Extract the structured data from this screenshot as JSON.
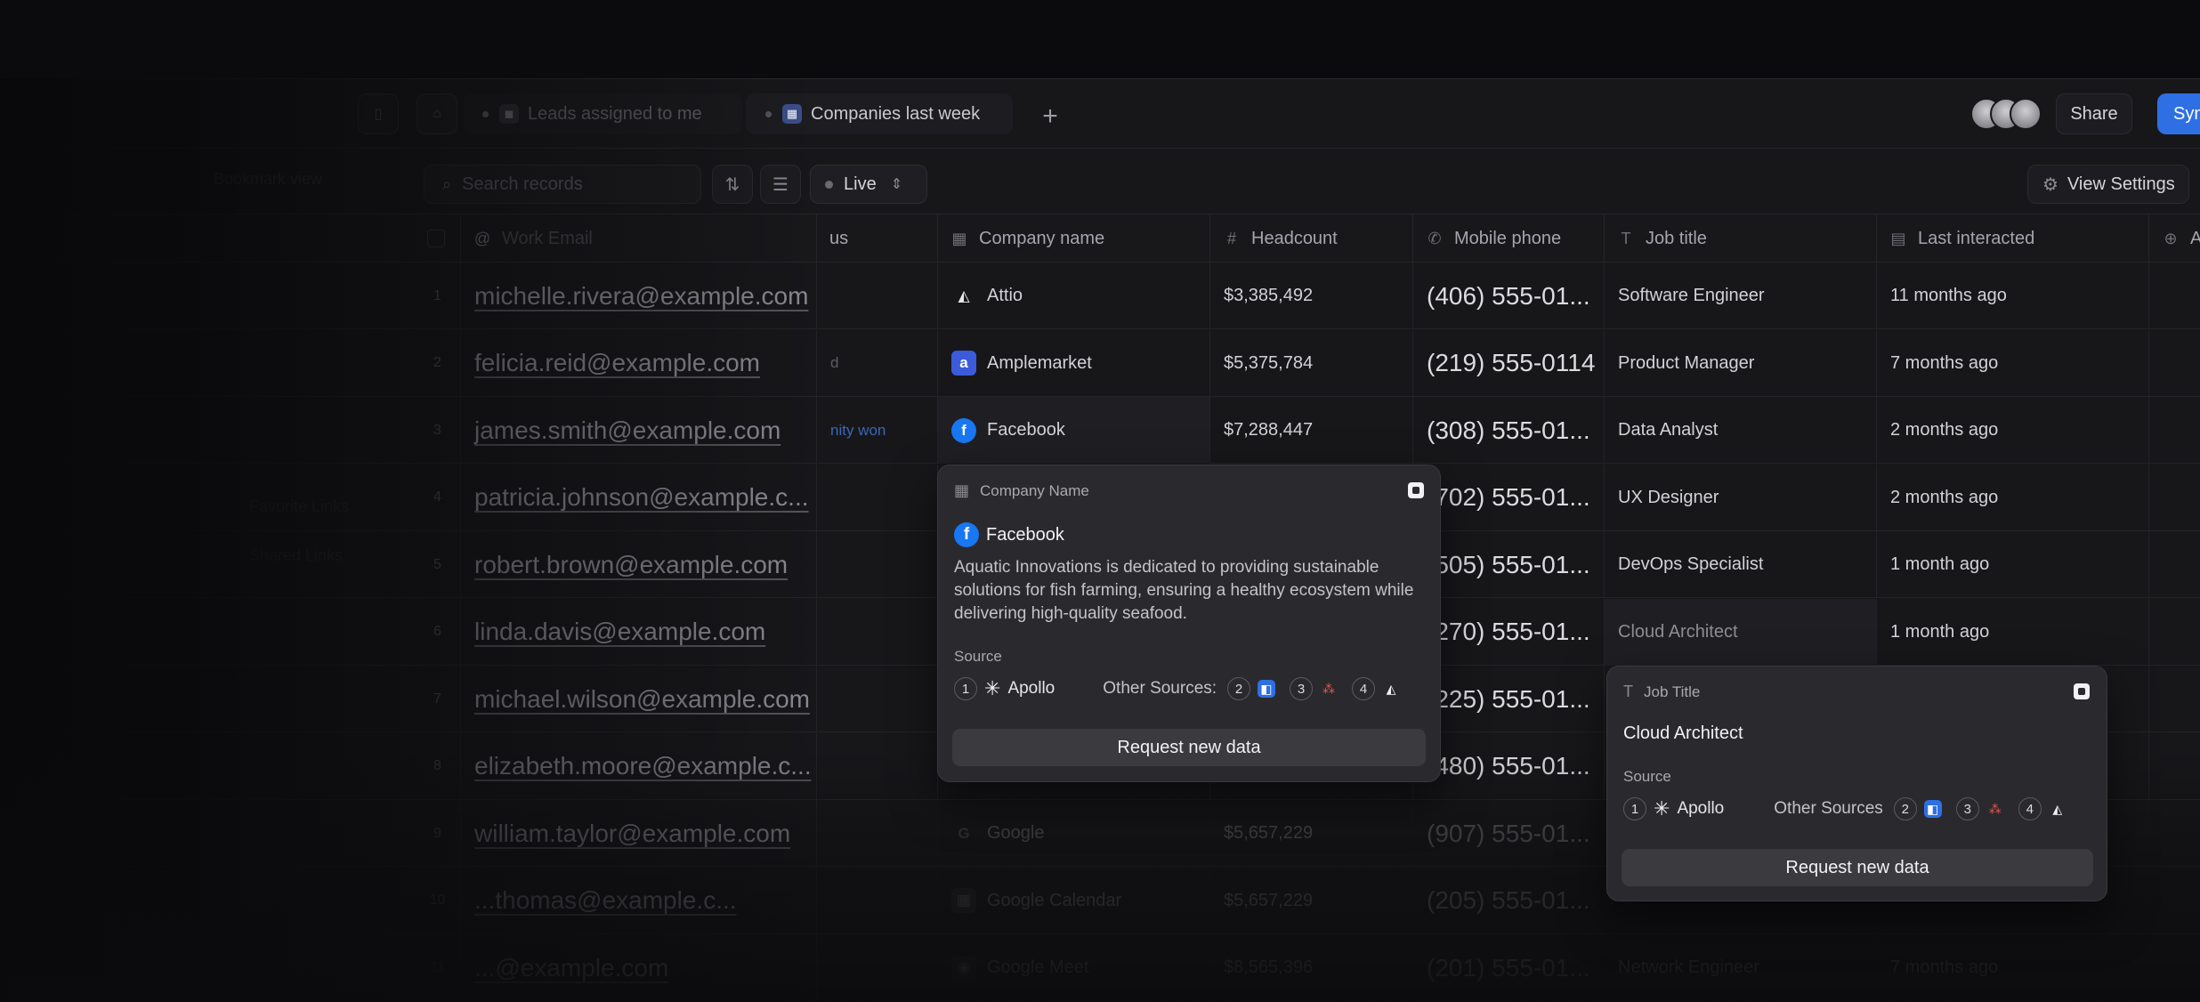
{
  "tabs": [
    {
      "label": "Leads assigned to me"
    },
    {
      "label": "Companies last week"
    }
  ],
  "share_label": "Share",
  "sync_label": "Syn",
  "left_label": "Bookmark view",
  "search": {
    "placeholder": "Search records"
  },
  "live_label": "Live",
  "view_settings_label": "View Settings",
  "columns": {
    "email": "Work Email",
    "status": "us",
    "company": "Company name",
    "headcount": "Headcount",
    "phone": "Mobile phone",
    "job": "Job title",
    "last": "Last interacted",
    "add": "A"
  },
  "rows": [
    {
      "num": "1",
      "email": "michelle.rivera@example.com",
      "status": "",
      "company": "Attio",
      "headcount": "$3,385,492",
      "phone": "(406) 555-01...",
      "job": "Software Engineer",
      "last": "11 months ago"
    },
    {
      "num": "2",
      "email": "felicia.reid@example.com",
      "status": "d",
      "company": "Amplemarket",
      "headcount": "$5,375,784",
      "phone": "(219) 555-0114",
      "job": "Product Manager",
      "last": "7 months ago"
    },
    {
      "num": "3",
      "email": "james.smith@example.com",
      "status": "nity won",
      "company": "Facebook",
      "headcount": "$7,288,447",
      "phone": "(308) 555-01...",
      "job": "Data Analyst",
      "last": "2 months ago"
    },
    {
      "num": "4",
      "email": "patricia.johnson@example.c...",
      "status": "",
      "company": "",
      "headcount": "",
      "phone": "(702) 555-01...",
      "job": "UX Designer",
      "last": "2 months ago"
    },
    {
      "num": "5",
      "email": "robert.brown@example.com",
      "status": "",
      "company": "",
      "headcount": "",
      "phone": "(505) 555-01...",
      "job": "DevOps Specialist",
      "last": "1 month ago"
    },
    {
      "num": "6",
      "email": "linda.davis@example.com",
      "status": "",
      "company": "",
      "headcount": "",
      "phone": "(270) 555-01...",
      "job": "Cloud Architect",
      "last": "1 month ago"
    },
    {
      "num": "7",
      "email": "michael.wilson@example.com",
      "status": "",
      "company": "",
      "headcount": "",
      "phone": "(225) 555-01...",
      "job": "",
      "last": ""
    },
    {
      "num": "8",
      "email": "elizabeth.moore@example.c...",
      "status": "",
      "company": "",
      "headcount": "",
      "phone": "(480) 555-01...",
      "job": "",
      "last": ""
    },
    {
      "num": "9",
      "email": "william.taylor@example.com",
      "status": "",
      "company": "Google",
      "headcount": "$5,657,229",
      "phone": "(907) 555-01...",
      "job": "",
      "last": ""
    },
    {
      "num": "10",
      "email": "...thomas@example.c...",
      "status": "",
      "company": "Google Calendar",
      "headcount": "$5,657,229",
      "phone": "(205) 555-01...",
      "job": "",
      "last": ""
    },
    {
      "num": "11",
      "email": "...@example.com",
      "status": "",
      "company": "Google Meet",
      "headcount": "$8,565,396",
      "phone": "(201) 555-01...",
      "job": "Network Engineer",
      "last": "7 months ago"
    }
  ],
  "sidebar_ghost": [
    "Favorite Links",
    "Shared Links"
  ],
  "company_popover": {
    "header": "Company Name",
    "title": "Facebook",
    "description": "Aquatic Innovations is dedicated to providing sustainable solutions for fish farming, ensuring a healthy ecosystem while delivering high-quality seafood.",
    "source_label": "Source",
    "primary_badge": "1",
    "primary_source": "Apollo",
    "other_label": "Other Sources:",
    "others": [
      "2",
      "3",
      "4"
    ],
    "button": "Request new data"
  },
  "job_popover": {
    "header": "Job Title",
    "title": "Cloud Architect",
    "source_label": "Source",
    "primary_badge": "1",
    "primary_source": "Apollo",
    "other_label": "Other Sources",
    "others": [
      "2",
      "3",
      "4"
    ],
    "button": "Request new data"
  },
  "colors": {
    "accent": "#2f6fe4",
    "facebook": "#1877f2",
    "amplemarket": "#3b5bdb"
  }
}
